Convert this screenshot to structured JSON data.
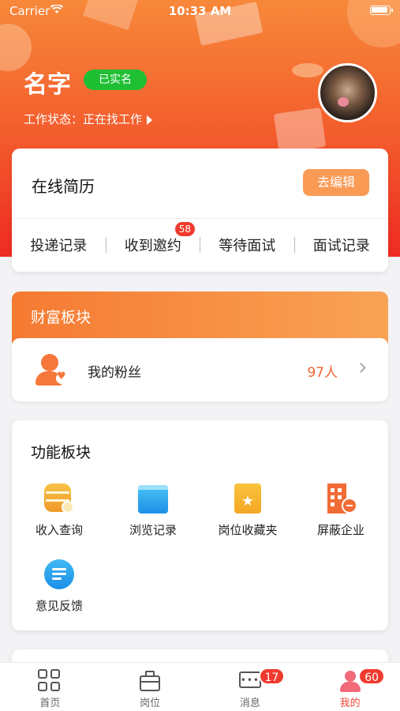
{
  "status_bar": {
    "carrier": "Carrier",
    "time": "10:33 AM"
  },
  "profile": {
    "name": "名字",
    "verified_label": "已实名",
    "work_status": "工作状态：正在找工作"
  },
  "resume": {
    "title": "在线简历",
    "edit_label": "去编辑",
    "links": [
      {
        "label": "投递记录"
      },
      {
        "label": "收到邀约",
        "badge": "58"
      },
      {
        "label": "等待面试"
      },
      {
        "label": "面试记录"
      }
    ]
  },
  "wealth": {
    "title": "财富板块",
    "fans_label": "我的粉丝",
    "fans_count": "97人"
  },
  "functions": {
    "title": "功能板块",
    "items": [
      {
        "label": "收入查询",
        "icon": "income-query-icon"
      },
      {
        "label": "浏览记录",
        "icon": "browse-history-icon"
      },
      {
        "label": "岗位收藏夹",
        "icon": "job-favorites-icon"
      },
      {
        "label": "屏蔽企业",
        "icon": "block-company-icon"
      },
      {
        "label": "意见反馈",
        "icon": "feedback-icon"
      }
    ]
  },
  "tabbar": {
    "tabs": [
      {
        "label": "首页",
        "icon": "home-grid-icon"
      },
      {
        "label": "岗位",
        "icon": "briefcase-icon"
      },
      {
        "label": "消息",
        "icon": "message-icon",
        "badge": "17"
      },
      {
        "label": "我的",
        "icon": "user-icon",
        "badge": "60",
        "active": true
      }
    ]
  },
  "colors": {
    "accent": "#f35a2c",
    "badge": "#f03a2e",
    "verified": "#1fbf33",
    "active_tab": "#f0483a"
  }
}
